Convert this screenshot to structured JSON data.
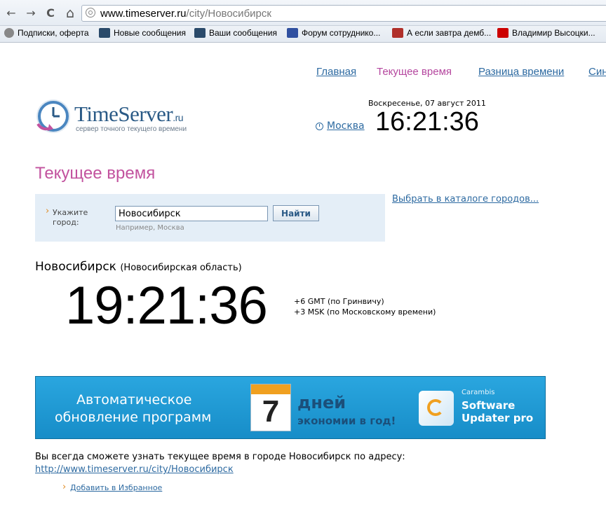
{
  "browser": {
    "url_host": "www.timeserver.ru",
    "url_path": "/city/Новосибирск",
    "back_icon": "←",
    "forward_icon": "→",
    "reload_icon": "C",
    "home_icon": "⌂"
  },
  "bookmarks": [
    {
      "label": "Подписки, оферта",
      "icon_color": "#888888"
    },
    {
      "label": "Новые сообщения",
      "icon_color": "#2a4a6a"
    },
    {
      "label": "Ваши сообщения",
      "icon_color": "#2a4a6a"
    },
    {
      "label": "Форум сотруднико...",
      "icon_color": "#3050a0"
    },
    {
      "label": "А если завтра демб...",
      "icon_color": "#b0302a"
    },
    {
      "label": "Владимир Высоцки...",
      "icon_color": "#cc0000"
    }
  ],
  "nav": {
    "items": [
      "Главная",
      "Текущее время",
      "Разница времени",
      "Син"
    ],
    "active_index": 1
  },
  "logo": {
    "name": "TimeServer",
    "tld": ".ru",
    "tagline": "сервер точного текущего времени"
  },
  "moscow": {
    "date": "Воскресенье, 07 август 2011",
    "link": "Москва",
    "time": "16:21:36"
  },
  "page_title": "Текущее время",
  "search": {
    "label": "Укажите город:",
    "value": "Новосибирск",
    "button": "Найти",
    "hint": "Например, Москва"
  },
  "catalog_link": "Выбрать в каталоге городов...",
  "city": {
    "name": "Новосибирск",
    "region": "(Новосибирская область)",
    "time": "19:21:36",
    "gmt": "+6 GMT (по Гринвичу)",
    "msk": "+3 MSK (по Московскому времени)"
  },
  "banner": {
    "line1": "Автоматическое",
    "line2": "обновление программ",
    "calendar_number": "7",
    "days": "дней",
    "savings": "экономии в год!",
    "brand": "Carambis",
    "product1": "Software",
    "product2": "Updater pro"
  },
  "footer": {
    "info": "Вы всегда сможете узнать текущее время в городе Новосибирск по адресу:",
    "url": "http://www.timeserver.ru/city/Новосибирск",
    "favorite": "Добавить в Избранное"
  },
  "colors": {
    "accent_link": "#2d6aa1",
    "title_pink": "#c2529e",
    "banner_blue": "#1f9ad6"
  }
}
